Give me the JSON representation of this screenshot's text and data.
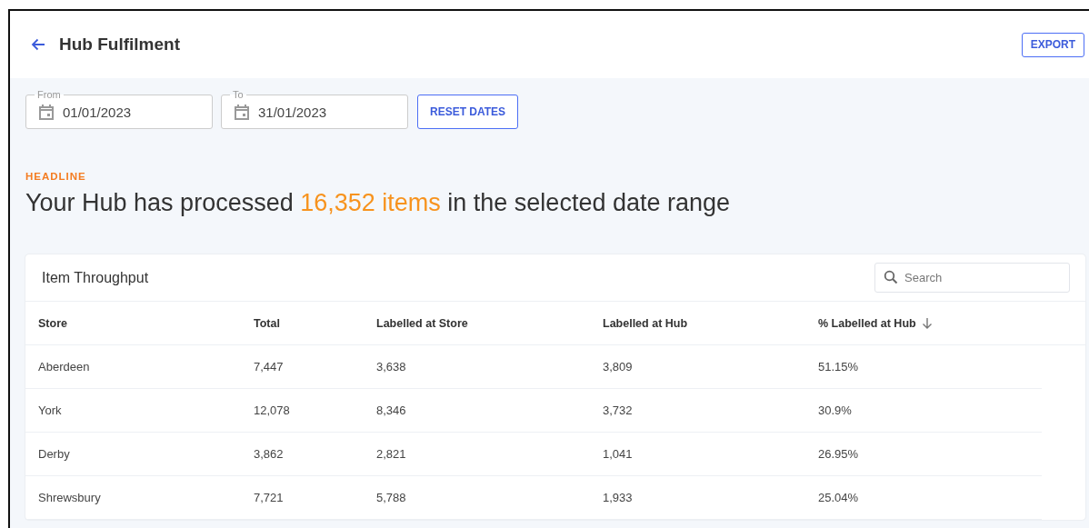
{
  "header": {
    "title": "Hub Fulfilment",
    "export_button": "EXPORT"
  },
  "date_range": {
    "from": {
      "label": "From",
      "value": "01/01/2023"
    },
    "to": {
      "label": "To",
      "value": "31/01/2023"
    },
    "reset_button": "RESET DATES"
  },
  "headline": {
    "eyebrow": "HEADLINE",
    "prefix": "Your Hub has processed",
    "highlight": "16,352 items",
    "suffix": "in the selected date range"
  },
  "table": {
    "title": "Item Throughput",
    "search": {
      "placeholder": "Search"
    },
    "columns": [
      {
        "label": "Store",
        "sorted": false
      },
      {
        "label": "Total",
        "sorted": false
      },
      {
        "label": "Labelled at Store",
        "sorted": false
      },
      {
        "label": "Labelled at Hub",
        "sorted": false
      },
      {
        "label": "% Labelled at Hub",
        "sorted": true
      }
    ],
    "rows": [
      [
        "Aberdeen",
        "7,447",
        "3,638",
        "3,809",
        "51.15%"
      ],
      [
        "York",
        "12,078",
        "8,346",
        "3,732",
        "30.9%"
      ],
      [
        "Derby",
        "3,862",
        "2,821",
        "1,041",
        "26.95%"
      ],
      [
        "Shrewsbury",
        "7,721",
        "5,788",
        "1,933",
        "25.04%"
      ]
    ]
  }
}
